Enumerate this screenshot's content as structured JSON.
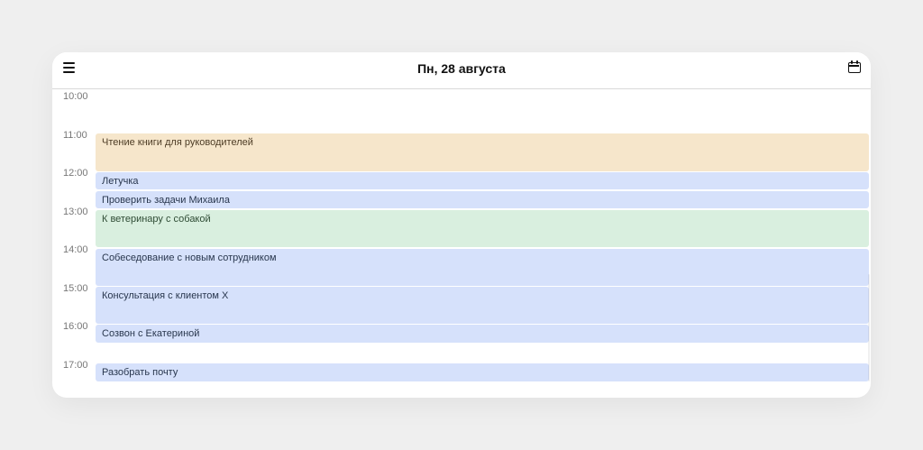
{
  "header": {
    "title": "Пн, 28 августа",
    "icons": {
      "menu": "menu-icon",
      "calendar": "calendar-icon"
    }
  },
  "timeline": {
    "times": [
      "10:00",
      "11:00",
      "12:00",
      "13:00",
      "14:00",
      "15:00",
      "16:00",
      "17:00"
    ],
    "events": [
      {
        "title": "Чтение книги для руководителей",
        "color": "#f6e6cb"
      },
      {
        "title": "Летучка",
        "color": "#d6e1fb"
      },
      {
        "title": "Проверить задачи Михаила",
        "color": "#d6e1fb"
      },
      {
        "title": "К ветеринару с собакой",
        "color": "#d9efdf"
      },
      {
        "title": "Собеседование с новым сотрудником",
        "color": "#d6e1fb"
      },
      {
        "title": "Консультация с клиентом Х",
        "color": "#d6e1fb"
      },
      {
        "title": "Созвон с Екатериной",
        "color": "#d6e1fb"
      },
      {
        "title": "Разобрать почту",
        "color": "#d6e1fb"
      }
    ]
  }
}
